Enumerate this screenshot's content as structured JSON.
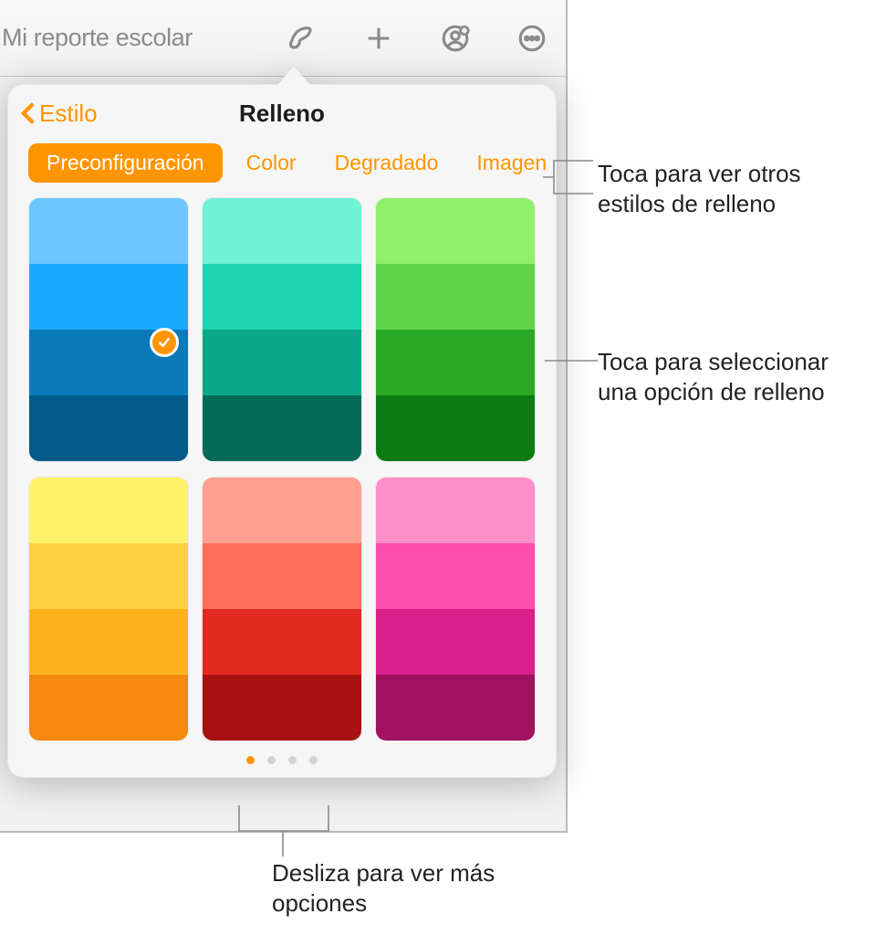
{
  "toolbar": {
    "doc_title": "Mi reporte escolar"
  },
  "popover": {
    "back_label": "Estilo",
    "title": "Relleno",
    "segments": {
      "preset": "Preconfiguración",
      "color": "Color",
      "gradient": "Degradado",
      "image": "Imagen"
    },
    "pages": {
      "count": 4,
      "active": 0
    },
    "selected": {
      "card": 0,
      "band": 2
    },
    "palettes_row1": [
      [
        "#6ec6ff",
        "#1ba9ff",
        "#0a7ab8",
        "#015a88"
      ],
      [
        "#6ff2d6",
        "#1fd4ae",
        "#0aa889",
        "#056b57"
      ],
      [
        "#8ff06a",
        "#5fd44a",
        "#2aaa24",
        "#0b7b12"
      ]
    ],
    "palettes_row2": [
      [
        "#fff26a",
        "#ffd042",
        "#ffb21e",
        "#f5890d"
      ],
      [
        "#ff9f92",
        "#ff6e5d",
        "#e22b20",
        "#a81111"
      ],
      [
        "#ff8fc9",
        "#ff4db0",
        "#d81f8a",
        "#a0115f"
      ]
    ]
  },
  "callouts": {
    "tabs": "Toca para ver otros estilos de relleno",
    "swatch": "Toca para seleccionar una opción de relleno",
    "swipe": "Desliza para ver más opciones"
  }
}
